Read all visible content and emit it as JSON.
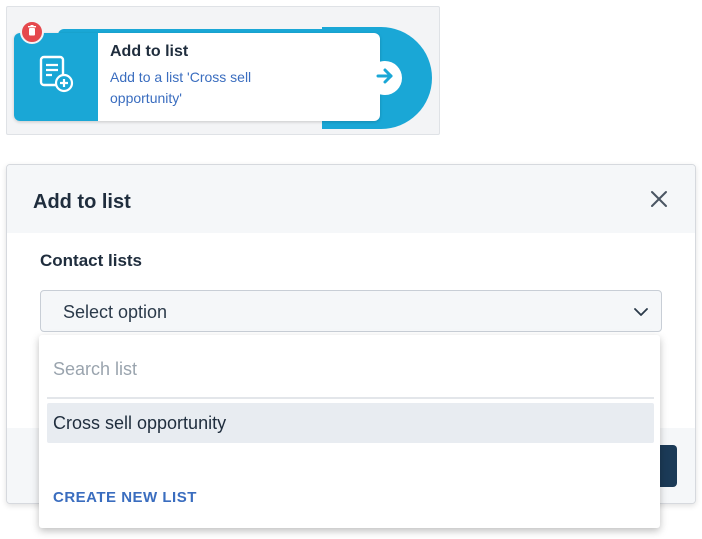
{
  "node": {
    "title": "Add to list",
    "description": "Add to a list 'Cross sell opportunity'",
    "icon": "add-to-list-icon",
    "action_icon": "arrow-right-icon",
    "delete_icon": "trash-icon"
  },
  "modal": {
    "title": "Add to list",
    "close_icon": "close-icon",
    "field_label": "Contact lists",
    "select": {
      "value": "Select option",
      "chevron_icon": "chevron-down-icon"
    }
  },
  "dropdown": {
    "search_placeholder": "Search list",
    "options": [
      "Cross sell opportunity"
    ],
    "create_label": "CREATE NEW LIST"
  },
  "colors": {
    "accent": "#1aa7d6",
    "link": "#3a6dbf",
    "delete": "#e5484d",
    "primary_dark": "#1b3a57"
  }
}
